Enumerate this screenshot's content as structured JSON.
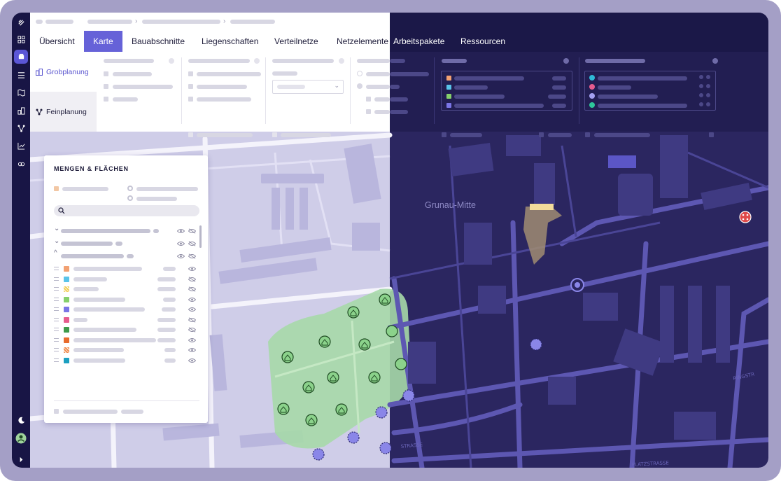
{
  "tabs": [
    {
      "label": "Übersicht",
      "active": false
    },
    {
      "label": "Karte",
      "active": true
    },
    {
      "label": "Bauabschnitte",
      "active": false
    },
    {
      "label": "Liegenschaften",
      "active": false
    },
    {
      "label": "Verteilnetze",
      "active": false
    },
    {
      "label": "Netzelemente",
      "active": false
    },
    {
      "label": "Arbeitspakete",
      "active": false
    },
    {
      "label": "Ressourcen",
      "active": false
    }
  ],
  "subnav": {
    "grob": "Grobplanung",
    "fein": "Feinplanung"
  },
  "panel": {
    "title": "MENGEN & FLÄCHEN"
  },
  "map": {
    "district_label": "Grunau-Mitte"
  },
  "legend_colors": [
    "#f2a172",
    "#59c3e9",
    "#f2cf5a",
    "#86d06b",
    "#7a75e6",
    "#e65c8e",
    "#3e9a4a",
    "#e86b2c",
    "#f08c4f",
    "#1b9fc0"
  ],
  "colors": {
    "accent": "#6662d8",
    "rail": "#181545",
    "dark_map": "#2a2560",
    "light_map": "#cfcde9",
    "green_area": "#a8dba8"
  },
  "icons": {
    "rail": [
      "grid-icon",
      "layers-icon",
      "list-icon",
      "map-icon",
      "buildings-icon",
      "network-icon",
      "chart-icon",
      "link-icon",
      "moon-icon",
      "avatar-icon",
      "expand-icon"
    ]
  }
}
